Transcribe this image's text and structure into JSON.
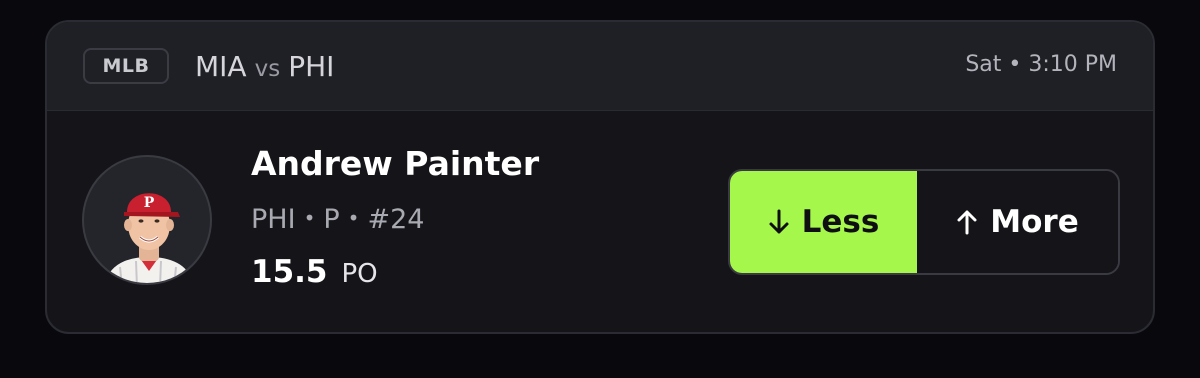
{
  "header": {
    "league": "MLB",
    "away_team": "MIA",
    "vs": "vs",
    "home_team": "PHI",
    "game_time": "Sat • 3:10 PM"
  },
  "player": {
    "name": "Andrew Painter",
    "team": "PHI",
    "position": "P",
    "number": "#24",
    "separator": "•",
    "avatar_icon": "player-headshot-icon"
  },
  "projection": {
    "value": "15.5",
    "stat": "PO"
  },
  "pick": {
    "less_label": "Less",
    "more_label": "More",
    "less_icon": "arrow-down-icon",
    "more_icon": "arrow-up-icon",
    "selected": "less",
    "accent_color": "#a6f74c"
  }
}
